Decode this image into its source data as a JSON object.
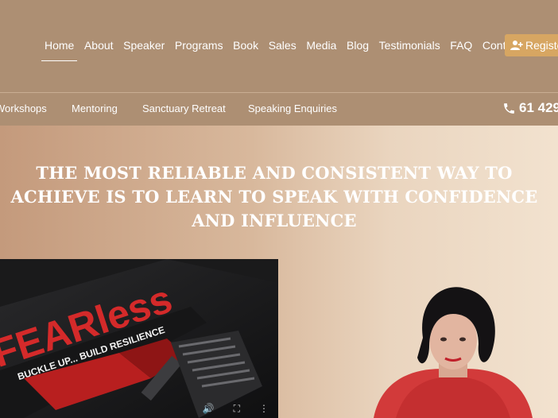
{
  "nav": {
    "items": [
      {
        "label": "Home",
        "active": true
      },
      {
        "label": "About"
      },
      {
        "label": "Speaker"
      },
      {
        "label": "Programs"
      },
      {
        "label": "Book"
      },
      {
        "label": "Sales"
      },
      {
        "label": "Media"
      },
      {
        "label": "Blog"
      },
      {
        "label": "Testimonials"
      },
      {
        "label": "FAQ"
      },
      {
        "label": "Contact"
      }
    ],
    "register_label": "Register"
  },
  "subnav": {
    "items": [
      {
        "label": "Workshops"
      },
      {
        "label": "Mentoring"
      },
      {
        "label": "Sanctuary Retreat"
      },
      {
        "label": "Speaking Enquiries"
      }
    ],
    "phone": "61 429"
  },
  "hero": {
    "title": "THE MOST RELIABLE AND CONSISTENT WAY TO ACHIEVE IS TO LEARN TO SPEAK WITH CONFIDENCE AND INFLUENCE"
  },
  "video": {
    "cover_title": "FEARless",
    "cover_subtitle": "BUCKLE UP... BUILD RESILIENCE"
  },
  "colors": {
    "nav_bg": "#ad8f73",
    "register_bg": "#d7a662",
    "cover_red": "#d42a2a"
  }
}
